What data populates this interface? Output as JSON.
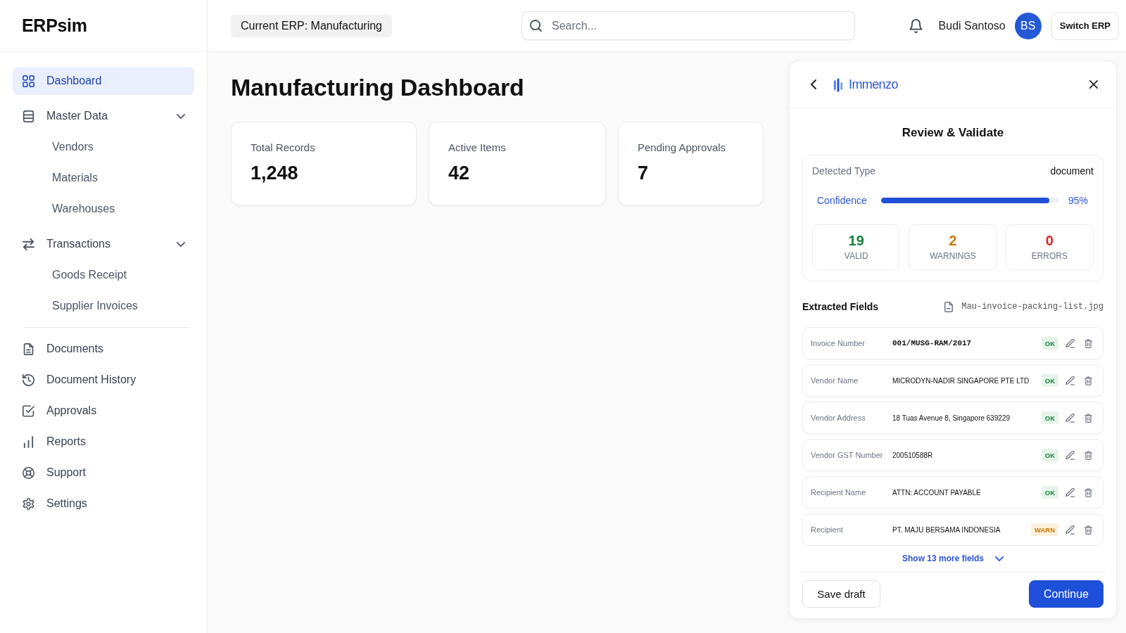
{
  "sidebar": {
    "logo": "ERPsim",
    "primary": [
      {
        "kind": "link",
        "label": "Dashboard",
        "selected": true
      },
      {
        "kind": "group",
        "label": "Master Data",
        "selected": false,
        "expanded": true,
        "children": [
          {
            "label": "Vendors",
            "selected": false
          },
          {
            "label": "Materials",
            "selected": false
          },
          {
            "label": "Warehouses",
            "selected": false
          }
        ]
      },
      {
        "kind": "group",
        "label": "Transactions",
        "selected": false,
        "expanded": true,
        "children": [
          {
            "label": "Goods Receipt",
            "selected": false
          },
          {
            "label": "Supplier Invoices",
            "selected": false
          }
        ]
      }
    ],
    "secondary": [
      {
        "label": "Documents",
        "selected": false
      },
      {
        "label": "Document History",
        "selected": false
      },
      {
        "label": "Approvals",
        "selected": false
      },
      {
        "label": "Reports",
        "selected": false
      },
      {
        "label": "Support",
        "selected": false
      },
      {
        "label": "Settings",
        "selected": false
      }
    ]
  },
  "topbar": {
    "erp_label": "Current ERP: Manufacturing",
    "search": {
      "placeholder": "Search..."
    },
    "user": {
      "name": "Budi Santoso",
      "initials": "BS"
    },
    "switch_button": "Switch ERP"
  },
  "dashboard": {
    "title": "Manufacturing Dashboard",
    "stats": [
      {
        "label": "Total Records",
        "value": "1,248"
      },
      {
        "label": "Active Items",
        "value": "42"
      },
      {
        "label": "Pending Approvals",
        "value": "7"
      }
    ]
  },
  "review_panel": {
    "brand": "Immenzo",
    "title": "Review & Validate",
    "detected_type": {
      "label": "Detected Type",
      "value": "document"
    },
    "confidence": {
      "label": "Confidence",
      "level": 0.95,
      "reading": "95%"
    },
    "counts": [
      {
        "kind": "valid",
        "value": "19",
        "label": "VALID"
      },
      {
        "kind": "warning",
        "value": "2",
        "label": "WARNINGS"
      },
      {
        "kind": "error",
        "value": "0",
        "label": "ERRORS"
      }
    ],
    "fields_heading": "Extracted Fields",
    "file_name": "Mau-invoice-packing-list.jpg",
    "fields": [
      {
        "kind": "code",
        "label": "Invoice Number",
        "value": "001/MUSG-RAM/2017",
        "status": {
          "kind": "ok",
          "text": "OK"
        }
      },
      {
        "kind": "text",
        "label": "Vendor Name",
        "value": "MICRODYN-NADIR SINGAPORE PTE LTD",
        "status": {
          "kind": "ok",
          "text": "OK"
        }
      },
      {
        "kind": "text",
        "label": "Vendor Address",
        "value": "18 Tuas Avenue 8, Singapore 639229",
        "status": {
          "kind": "ok",
          "text": "OK"
        }
      },
      {
        "kind": "text",
        "label": "Vendor GST Number",
        "value": "200510588R",
        "status": {
          "kind": "ok",
          "text": "OK"
        }
      },
      {
        "kind": "text",
        "label": "Recipient Name",
        "value": "ATTN: ACCOUNT PAYABLE",
        "status": {
          "kind": "ok",
          "text": "OK"
        }
      },
      {
        "kind": "text",
        "label": "Recipient",
        "value": "PT. MAJU BERSAMA INDONESIA",
        "status": {
          "kind": "warn",
          "text": "WARN"
        }
      }
    ],
    "more_link": "Show 13 more fields",
    "buttons": [
      {
        "kind": "secondary",
        "label": "Save draft"
      },
      {
        "kind": "primary",
        "label": "Continue"
      }
    ]
  }
}
